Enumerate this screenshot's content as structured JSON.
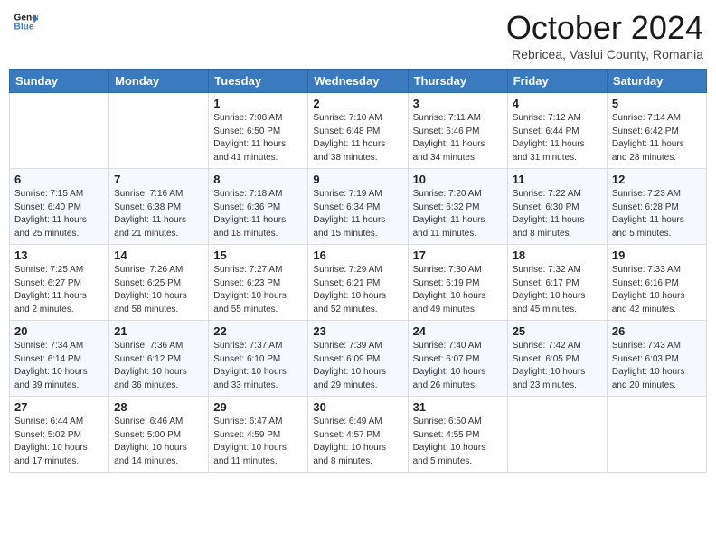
{
  "header": {
    "logo_line1": "General",
    "logo_line2": "Blue",
    "month": "October 2024",
    "location": "Rebricea, Vaslui County, Romania"
  },
  "days_of_week": [
    "Sunday",
    "Monday",
    "Tuesday",
    "Wednesday",
    "Thursday",
    "Friday",
    "Saturday"
  ],
  "weeks": [
    [
      {
        "day": "",
        "sunrise": "",
        "sunset": "",
        "daylight": ""
      },
      {
        "day": "",
        "sunrise": "",
        "sunset": "",
        "daylight": ""
      },
      {
        "day": "1",
        "sunrise": "Sunrise: 7:08 AM",
        "sunset": "Sunset: 6:50 PM",
        "daylight": "Daylight: 11 hours and 41 minutes."
      },
      {
        "day": "2",
        "sunrise": "Sunrise: 7:10 AM",
        "sunset": "Sunset: 6:48 PM",
        "daylight": "Daylight: 11 hours and 38 minutes."
      },
      {
        "day": "3",
        "sunrise": "Sunrise: 7:11 AM",
        "sunset": "Sunset: 6:46 PM",
        "daylight": "Daylight: 11 hours and 34 minutes."
      },
      {
        "day": "4",
        "sunrise": "Sunrise: 7:12 AM",
        "sunset": "Sunset: 6:44 PM",
        "daylight": "Daylight: 11 hours and 31 minutes."
      },
      {
        "day": "5",
        "sunrise": "Sunrise: 7:14 AM",
        "sunset": "Sunset: 6:42 PM",
        "daylight": "Daylight: 11 hours and 28 minutes."
      }
    ],
    [
      {
        "day": "6",
        "sunrise": "Sunrise: 7:15 AM",
        "sunset": "Sunset: 6:40 PM",
        "daylight": "Daylight: 11 hours and 25 minutes."
      },
      {
        "day": "7",
        "sunrise": "Sunrise: 7:16 AM",
        "sunset": "Sunset: 6:38 PM",
        "daylight": "Daylight: 11 hours and 21 minutes."
      },
      {
        "day": "8",
        "sunrise": "Sunrise: 7:18 AM",
        "sunset": "Sunset: 6:36 PM",
        "daylight": "Daylight: 11 hours and 18 minutes."
      },
      {
        "day": "9",
        "sunrise": "Sunrise: 7:19 AM",
        "sunset": "Sunset: 6:34 PM",
        "daylight": "Daylight: 11 hours and 15 minutes."
      },
      {
        "day": "10",
        "sunrise": "Sunrise: 7:20 AM",
        "sunset": "Sunset: 6:32 PM",
        "daylight": "Daylight: 11 hours and 11 minutes."
      },
      {
        "day": "11",
        "sunrise": "Sunrise: 7:22 AM",
        "sunset": "Sunset: 6:30 PM",
        "daylight": "Daylight: 11 hours and 8 minutes."
      },
      {
        "day": "12",
        "sunrise": "Sunrise: 7:23 AM",
        "sunset": "Sunset: 6:28 PM",
        "daylight": "Daylight: 11 hours and 5 minutes."
      }
    ],
    [
      {
        "day": "13",
        "sunrise": "Sunrise: 7:25 AM",
        "sunset": "Sunset: 6:27 PM",
        "daylight": "Daylight: 11 hours and 2 minutes."
      },
      {
        "day": "14",
        "sunrise": "Sunrise: 7:26 AM",
        "sunset": "Sunset: 6:25 PM",
        "daylight": "Daylight: 10 hours and 58 minutes."
      },
      {
        "day": "15",
        "sunrise": "Sunrise: 7:27 AM",
        "sunset": "Sunset: 6:23 PM",
        "daylight": "Daylight: 10 hours and 55 minutes."
      },
      {
        "day": "16",
        "sunrise": "Sunrise: 7:29 AM",
        "sunset": "Sunset: 6:21 PM",
        "daylight": "Daylight: 10 hours and 52 minutes."
      },
      {
        "day": "17",
        "sunrise": "Sunrise: 7:30 AM",
        "sunset": "Sunset: 6:19 PM",
        "daylight": "Daylight: 10 hours and 49 minutes."
      },
      {
        "day": "18",
        "sunrise": "Sunrise: 7:32 AM",
        "sunset": "Sunset: 6:17 PM",
        "daylight": "Daylight: 10 hours and 45 minutes."
      },
      {
        "day": "19",
        "sunrise": "Sunrise: 7:33 AM",
        "sunset": "Sunset: 6:16 PM",
        "daylight": "Daylight: 10 hours and 42 minutes."
      }
    ],
    [
      {
        "day": "20",
        "sunrise": "Sunrise: 7:34 AM",
        "sunset": "Sunset: 6:14 PM",
        "daylight": "Daylight: 10 hours and 39 minutes."
      },
      {
        "day": "21",
        "sunrise": "Sunrise: 7:36 AM",
        "sunset": "Sunset: 6:12 PM",
        "daylight": "Daylight: 10 hours and 36 minutes."
      },
      {
        "day": "22",
        "sunrise": "Sunrise: 7:37 AM",
        "sunset": "Sunset: 6:10 PM",
        "daylight": "Daylight: 10 hours and 33 minutes."
      },
      {
        "day": "23",
        "sunrise": "Sunrise: 7:39 AM",
        "sunset": "Sunset: 6:09 PM",
        "daylight": "Daylight: 10 hours and 29 minutes."
      },
      {
        "day": "24",
        "sunrise": "Sunrise: 7:40 AM",
        "sunset": "Sunset: 6:07 PM",
        "daylight": "Daylight: 10 hours and 26 minutes."
      },
      {
        "day": "25",
        "sunrise": "Sunrise: 7:42 AM",
        "sunset": "Sunset: 6:05 PM",
        "daylight": "Daylight: 10 hours and 23 minutes."
      },
      {
        "day": "26",
        "sunrise": "Sunrise: 7:43 AM",
        "sunset": "Sunset: 6:03 PM",
        "daylight": "Daylight: 10 hours and 20 minutes."
      }
    ],
    [
      {
        "day": "27",
        "sunrise": "Sunrise: 6:44 AM",
        "sunset": "Sunset: 5:02 PM",
        "daylight": "Daylight: 10 hours and 17 minutes."
      },
      {
        "day": "28",
        "sunrise": "Sunrise: 6:46 AM",
        "sunset": "Sunset: 5:00 PM",
        "daylight": "Daylight: 10 hours and 14 minutes."
      },
      {
        "day": "29",
        "sunrise": "Sunrise: 6:47 AM",
        "sunset": "Sunset: 4:59 PM",
        "daylight": "Daylight: 10 hours and 11 minutes."
      },
      {
        "day": "30",
        "sunrise": "Sunrise: 6:49 AM",
        "sunset": "Sunset: 4:57 PM",
        "daylight": "Daylight: 10 hours and 8 minutes."
      },
      {
        "day": "31",
        "sunrise": "Sunrise: 6:50 AM",
        "sunset": "Sunset: 4:55 PM",
        "daylight": "Daylight: 10 hours and 5 minutes."
      },
      {
        "day": "",
        "sunrise": "",
        "sunset": "",
        "daylight": ""
      },
      {
        "day": "",
        "sunrise": "",
        "sunset": "",
        "daylight": ""
      }
    ]
  ]
}
